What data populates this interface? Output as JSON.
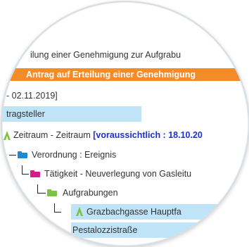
{
  "rows": {
    "r1": "ilung einer Genehmigung zur Aufgrabu",
    "r2": "Antrag auf Erteilung einer Genehmigung",
    "r3": "- 02.11.2019]",
    "r4": "tragsteller",
    "r5_plain": "Zeitraum - Zeitraum ",
    "r5_bold": "[voraussichtlich : 18.10.20",
    "r6": "Verordnung : Ereignis",
    "r7": "Tätigkeit - Neuverlegung von Gasleitu",
    "r8": "Aufgrabungen",
    "r9": "Grazbachgasse Hauptfa",
    "r10": "Pestalozzistraße"
  },
  "colors": {
    "orange_bar": "#f28c28",
    "blue_highlight": "#bfe3f7",
    "folder_blue": "#1e88d0",
    "folder_magenta": "#d81b8c",
    "folder_green": "#7cc243",
    "emphasis_blue": "#1d2fd6"
  },
  "icons": [
    "folder-icon-blue",
    "folder-icon-magenta",
    "folder-icon-green",
    "marker-icon-green"
  ]
}
